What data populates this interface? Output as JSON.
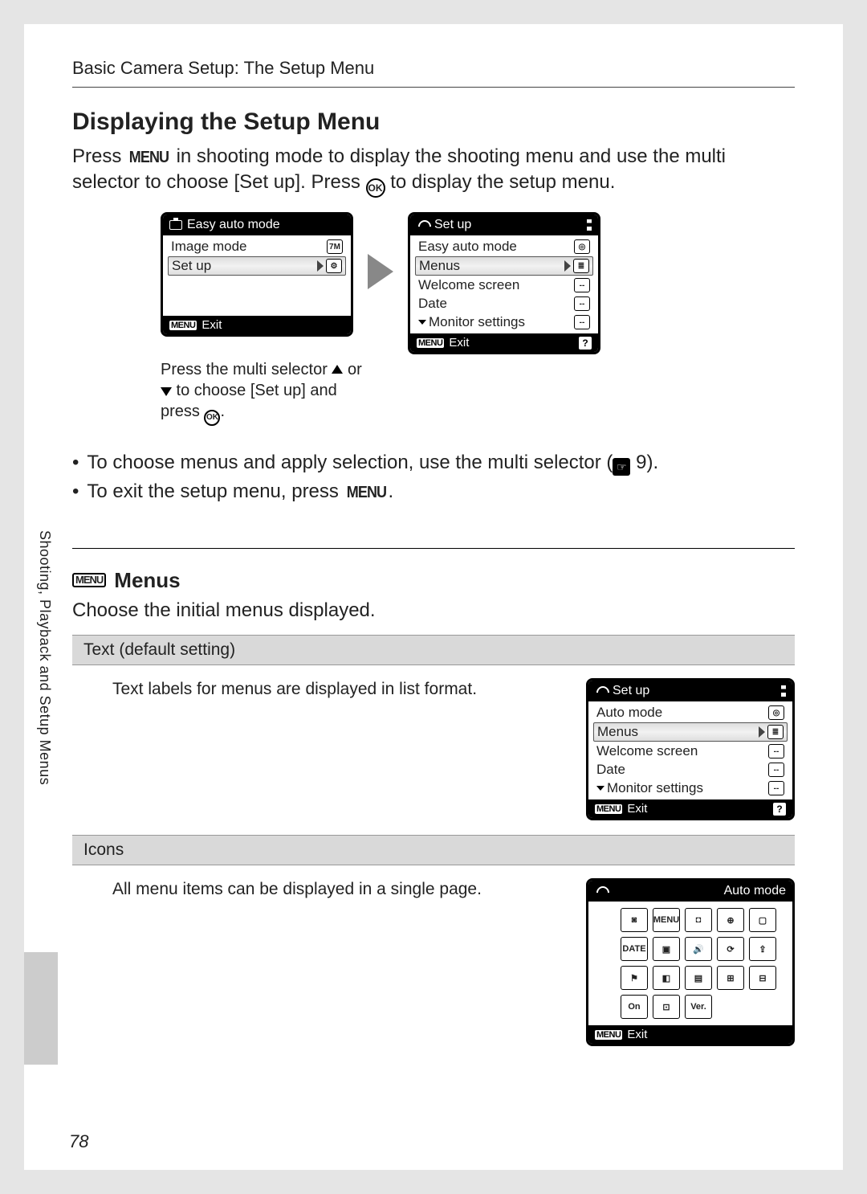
{
  "breadcrumb": "Basic Camera Setup: The Setup Menu",
  "section_title": "Displaying the Setup Menu",
  "intro_1a": "Press ",
  "intro_menu": "MENU",
  "intro_1b": " in shooting mode to display the shooting menu and use the multi selector to choose [Set up]. Press ",
  "intro_1c": " to display the setup menu.",
  "ok_label": "OK",
  "screen1": {
    "title": "Easy auto mode",
    "rows": [
      {
        "label": "Image mode",
        "icon": "7M"
      },
      {
        "label": "Set up",
        "selected": true
      }
    ],
    "exit_menu": "MENU",
    "exit": "Exit"
  },
  "screen2": {
    "title": "Set up",
    "rows": [
      {
        "label": "Easy auto mode",
        "icon": "◎"
      },
      {
        "label": "Menus",
        "selected": true,
        "icon": "≣"
      },
      {
        "label": "Welcome screen",
        "icon": "--"
      },
      {
        "label": "Date",
        "icon": "--"
      },
      {
        "label": "Monitor settings",
        "icon": "--",
        "down": true
      }
    ],
    "exit_menu": "MENU",
    "exit": "Exit",
    "help": "?"
  },
  "caption_a": "Press the multi selector ",
  "caption_b": " or ",
  "caption_c": " to choose [Set up] and press ",
  "caption_d": ".",
  "bullet1_a": "To choose menus and apply selection, use the multi selector (",
  "bullet1_ref": "9",
  "bullet1_b": ").",
  "bullet2_a": "To exit the setup menu, press ",
  "bullet2_b": ".",
  "menus_heading_icon": "MENU",
  "menus_heading": "Menus",
  "menus_desc": "Choose the initial menus displayed.",
  "option_text": {
    "head": "Text (default setting)",
    "desc": "Text labels for menus are displayed in list format.",
    "screen": {
      "title": "Set up",
      "rows": [
        {
          "label": "Auto mode",
          "icon": "◎"
        },
        {
          "label": "Menus",
          "selected": true,
          "icon": "≣"
        },
        {
          "label": "Welcome screen",
          "icon": "--"
        },
        {
          "label": "Date",
          "icon": "--"
        },
        {
          "label": "Monitor settings",
          "icon": "--",
          "down": true
        }
      ],
      "exit_menu": "MENU",
      "exit": "Exit",
      "help": "?"
    }
  },
  "option_icons": {
    "head": "Icons",
    "desc": "All menu items can be displayed in a single page.",
    "screen": {
      "title_right": "Auto mode",
      "cells": [
        "◙",
        "MENU",
        "◘",
        "⊕",
        "▢",
        "DATE",
        "▣",
        "🔊",
        "⟳",
        "⇪",
        "⚑",
        "◧",
        "▤",
        "⊞",
        "⊟",
        "On",
        "⊡",
        "Ver.",
        "",
        ""
      ],
      "exit_menu": "MENU",
      "exit": "Exit"
    }
  },
  "side_label": "Shooting, Playback and Setup Menus",
  "page_number": "78"
}
